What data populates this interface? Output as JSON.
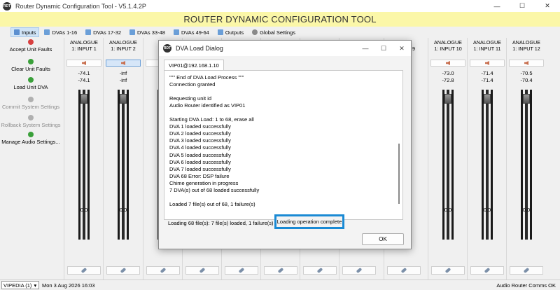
{
  "window": {
    "title": "Router Dynamic Configuration Tool - V5.1.4.2P",
    "icon_text": "RDT"
  },
  "banner": "ROUTER DYNAMIC CONFIGURATION TOOL",
  "tabs": [
    {
      "label": "Inputs",
      "icon": "inputs-icon",
      "active": true
    },
    {
      "label": "DVAs 1-16",
      "icon": "dva-icon"
    },
    {
      "label": "DVAs 17-32",
      "icon": "dva-icon"
    },
    {
      "label": "DVAs 33-48",
      "icon": "dva-icon"
    },
    {
      "label": "DVAs 49-64",
      "icon": "dva-icon"
    },
    {
      "label": "Outputs",
      "icon": "outputs-icon"
    },
    {
      "label": "Global Settings",
      "icon": "gear-icon"
    }
  ],
  "left_panel": [
    {
      "label": "Accept Unit Faults",
      "icon": "accept-faults-icon",
      "enabled": true
    },
    {
      "label": "Clear Unit Faults",
      "icon": "clear-faults-icon",
      "enabled": true
    },
    {
      "label": "Load Unit DVA",
      "icon": "load-dva-icon",
      "enabled": true
    },
    {
      "label": "Commit System Settings",
      "icon": "commit-icon",
      "enabled": false
    },
    {
      "label": "Rollback System Settings",
      "icon": "rollback-icon",
      "enabled": false
    },
    {
      "label": "Manage Audio Settings...",
      "icon": "manage-audio-icon",
      "enabled": true
    }
  ],
  "channels": [
    {
      "line1": "ANALOGUE",
      "line2": "1: INPUT 1",
      "level1": "-74.1",
      "level2": "-74.1",
      "gain": "0.0"
    },
    {
      "line1": "ANALOGUE",
      "line2": "1: INPUT 2",
      "level1": "-inf",
      "level2": "-inf",
      "gain": "0.0"
    },
    {
      "line1": "",
      "line2": "",
      "level1": "",
      "level2": "",
      "gain": ""
    },
    {
      "line1": "",
      "line2": "",
      "level1": "",
      "level2": "",
      "gain": ""
    },
    {
      "line1": "",
      "line2": "",
      "level1": "",
      "level2": "",
      "gain": ""
    },
    {
      "line1": "",
      "line2": "",
      "level1": "",
      "level2": "",
      "gain": ""
    },
    {
      "line1": "",
      "line2": "9",
      "level1": "",
      "level2": "",
      "gain": ""
    },
    {
      "line1": "ANALOGUE",
      "line2": "1: INPUT 10",
      "level1": "-73.0",
      "level2": "-72.8",
      "gain": "0.0"
    },
    {
      "line1": "ANALOGUE",
      "line2": "1: INPUT 11",
      "level1": "-71.4",
      "level2": "-71.4",
      "gain": "0.0"
    },
    {
      "line1": "ANALOGUE",
      "line2": "1: INPUT 12",
      "level1": "-70.5",
      "level2": "-70.4",
      "gain": "0.0"
    }
  ],
  "status_bar": {
    "unit": "VIPEDIA (1)",
    "unit_arrow": "▾",
    "datetime": "Mon 3 Aug 2026 16:03",
    "comms": "Audio Router Comms OK"
  },
  "dialog": {
    "title": "DVA Load Dialog",
    "tab": "VIP01@192.168.1.10",
    "log": [
      "\"\"\" End of DVA Load Process \"\"\"",
      "Connection granted",
      "",
      "Requesting unit id",
      "Audio Router identified as VIP01",
      "",
      "Starting DVA Load: 1 to 68, erase all",
      "DVA 1 loaded successfully",
      "DVA 2 loaded successfully",
      "DVA 3 loaded successfully",
      "DVA 4 loaded successfully",
      "DVA 5 loaded successfully",
      "DVA 6 loaded successfully",
      "DVA 7 loaded successfully",
      "DVA 68 Error: DSP failure",
      "Chime generation in progress",
      "7 DVA(s) out of 68 loaded successfully",
      "",
      "Loaded 7 file(s) out of 68, 1 failure(s)",
      "\"\"\" End of DVA Load Process \"\"\""
    ],
    "status_text": "Loading 68 file(s): 7 file(s) loaded, 1 failure(s)",
    "status_complete": "Loading operation complete",
    "ok_label": "OK",
    "controls": {
      "minimize": "—",
      "maximize": "☐",
      "close": "✕"
    }
  },
  "window_controls": {
    "minimize": "—",
    "maximize": "☐",
    "close": "✕"
  }
}
